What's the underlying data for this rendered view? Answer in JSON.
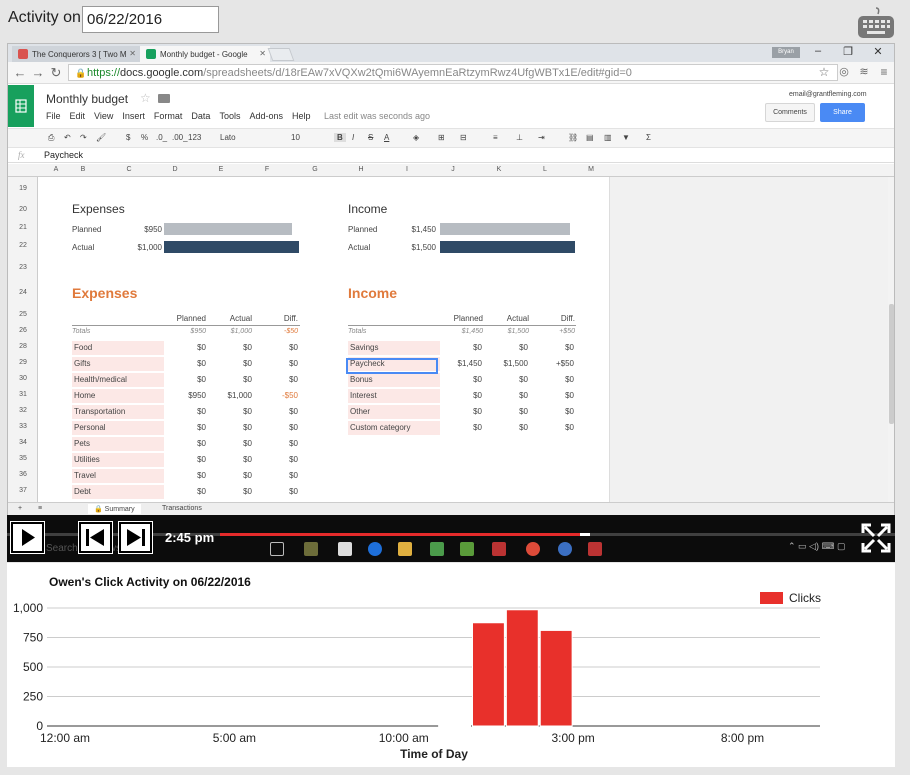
{
  "activity": {
    "label": "Activity on:",
    "date": "06/22/2016"
  },
  "browser": {
    "tabs": [
      {
        "title": "The Conquerors 3 [ Two M"
      },
      {
        "title": "Monthly budget - Google"
      }
    ],
    "user_badge": "Bryan",
    "url_https": "https://",
    "url_domain": "docs.google.com",
    "url_path": "/spreadsheets/d/18rEAw7xVQXw2tQmi6WAyemnEaRtzymRwz4UfgWBTx1E/edit#gid=0"
  },
  "sheets": {
    "title": "Monthly budget",
    "menu": [
      "File",
      "Edit",
      "View",
      "Insert",
      "Format",
      "Data",
      "Tools",
      "Add-ons",
      "Help"
    ],
    "last_edit": "Last edit was seconds ago",
    "email": "email@grantfleming.com",
    "comments_label": "Comments",
    "share_label": "Share",
    "toolbar": {
      "font": "Lato",
      "size": "10",
      "dollar": "$",
      "percent": "%",
      "dec0": ".0_",
      "dec00": ".00_",
      "fmt": "123"
    },
    "formula_value": "Paycheck",
    "columns": [
      "A",
      "B",
      "C",
      "D",
      "E",
      "F",
      "G",
      "H",
      "I",
      "J",
      "K",
      "L",
      "M"
    ],
    "rows": [
      "19",
      "20",
      "21",
      "22",
      "23",
      "24",
      "25",
      "26",
      "28",
      "29",
      "30",
      "31",
      "32",
      "33",
      "34",
      "35",
      "36",
      "37"
    ],
    "summary": {
      "expenses_title": "Expenses",
      "income_title": "Income",
      "planned_label": "Planned",
      "actual_label": "Actual",
      "exp_planned": "$950",
      "exp_actual": "$1,000",
      "inc_planned": "$1,450",
      "inc_actual": "$1,500"
    },
    "detail": {
      "headers": [
        "Planned",
        "Actual",
        "Diff."
      ],
      "totals_label": "Totals",
      "expenses_title": "Expenses",
      "income_title": "Income",
      "expenses_totals": [
        "$950",
        "$1,000",
        "-$50"
      ],
      "income_totals": [
        "$1,450",
        "$1,500",
        "+$50"
      ],
      "expenses": [
        {
          "name": "Food",
          "planned": "$0",
          "actual": "$0",
          "diff": "$0"
        },
        {
          "name": "Gifts",
          "planned": "$0",
          "actual": "$0",
          "diff": "$0"
        },
        {
          "name": "Health/medical",
          "planned": "$0",
          "actual": "$0",
          "diff": "$0"
        },
        {
          "name": "Home",
          "planned": "$950",
          "actual": "$1,000",
          "diff": "-$50"
        },
        {
          "name": "Transportation",
          "planned": "$0",
          "actual": "$0",
          "diff": "$0"
        },
        {
          "name": "Personal",
          "planned": "$0",
          "actual": "$0",
          "diff": "$0"
        },
        {
          "name": "Pets",
          "planned": "$0",
          "actual": "$0",
          "diff": "$0"
        },
        {
          "name": "Utilities",
          "planned": "$0",
          "actual": "$0",
          "diff": "$0"
        },
        {
          "name": "Travel",
          "planned": "$0",
          "actual": "$0",
          "diff": "$0"
        },
        {
          "name": "Debt",
          "planned": "$0",
          "actual": "$0",
          "diff": "$0"
        }
      ],
      "income": [
        {
          "name": "Savings",
          "planned": "$0",
          "actual": "$0",
          "diff": "$0"
        },
        {
          "name": "Paycheck",
          "planned": "$1,450",
          "actual": "$1,500",
          "diff": "+$50"
        },
        {
          "name": "Bonus",
          "planned": "$0",
          "actual": "$0",
          "diff": "$0"
        },
        {
          "name": "Interest",
          "planned": "$0",
          "actual": "$0",
          "diff": "$0"
        },
        {
          "name": "Other",
          "planned": "$0",
          "actual": "$0",
          "diff": "$0"
        },
        {
          "name": "Custom category",
          "planned": "$0",
          "actual": "$0",
          "diff": "$0"
        }
      ]
    },
    "sheet_tabs": [
      "Summary",
      "Transactions"
    ]
  },
  "video": {
    "time": "2:45 pm",
    "progress": 0.41,
    "search_ghost": "Search Windows"
  },
  "colors": {
    "accent_orange": "#e07a3c",
    "planned_bar": "#b7bcc2",
    "actual_bar": "#2f4a66",
    "click_red": "#e8302b"
  },
  "chart_data": {
    "type": "bar",
    "title": "Owen's Click Activity on 06/22/2016",
    "xlabel": "Time of Day",
    "ylabel": "",
    "legend": [
      "Clicks"
    ],
    "legend_position": "top-right",
    "x_ticks": [
      "12:00 am",
      "5:00 am",
      "10:00 am",
      "3:00 pm",
      "8:00 pm"
    ],
    "y_ticks": [
      "0",
      "250",
      "500",
      "750",
      "1,000"
    ],
    "ylim": [
      0,
      1000
    ],
    "xlim_hours": [
      0,
      24
    ],
    "bin_hours": 1,
    "grid": true,
    "series": [
      {
        "name": "Clicks",
        "bins": [
          {
            "hour": 11,
            "value": 8
          },
          {
            "hour": 12,
            "value": 875
          },
          {
            "hour": 13,
            "value": 985
          },
          {
            "hour": 14,
            "value": 810
          }
        ]
      }
    ]
  }
}
